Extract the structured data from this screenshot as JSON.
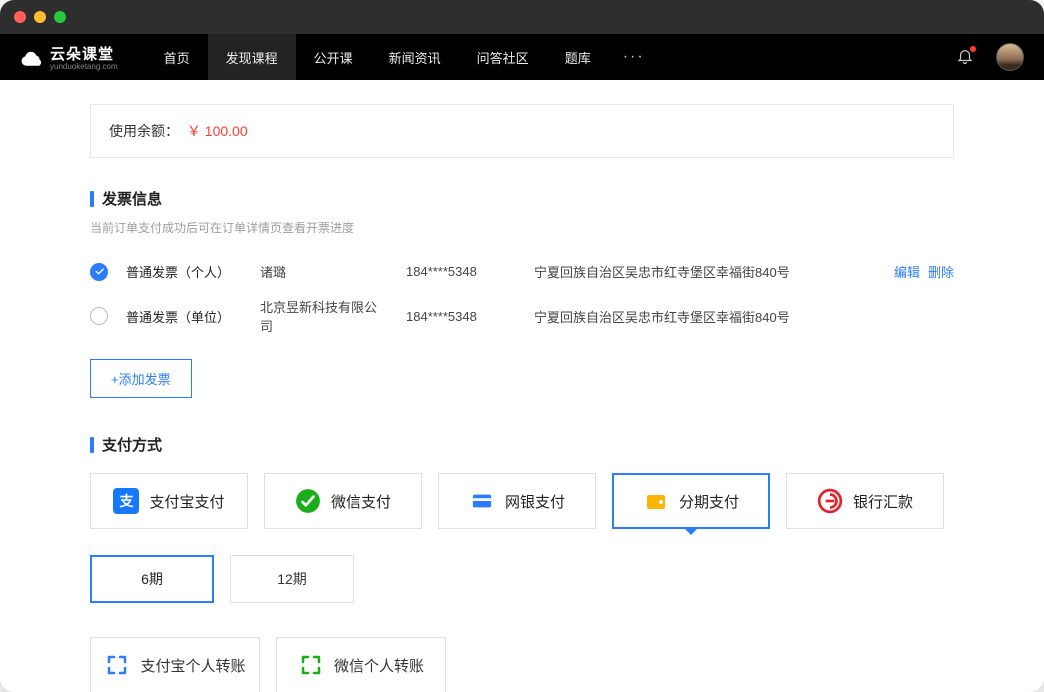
{
  "nav": {
    "logo_text": "云朵课堂",
    "logo_sub": "yunduoketang.com",
    "items": [
      "首页",
      "发现课程",
      "公开课",
      "新闻资讯",
      "问答社区",
      "题库"
    ],
    "active_index": 1
  },
  "balance": {
    "label": "使用余额：",
    "amount": "￥ 100.00"
  },
  "invoice": {
    "title": "发票信息",
    "subtitle": "当前订单支付成功后可在订单详情页查看开票进度",
    "rows": [
      {
        "type": "普通发票（个人）",
        "name": "诸璐",
        "phone": "184****5348",
        "address": "宁夏回族自治区吴忠市红寺堡区幸福街840号",
        "checked": true,
        "actions": [
          "编辑",
          "删除"
        ]
      },
      {
        "type": "普通发票（单位）",
        "name": "北京昱新科技有限公司",
        "phone": "184****5348",
        "address": "宁夏回族自治区吴忠市红寺堡区幸福街840号",
        "checked": false,
        "actions": []
      }
    ],
    "add_label": "+添加发票"
  },
  "payment": {
    "title": "支付方式",
    "methods": [
      {
        "label": "支付宝支付",
        "icon": "alipay"
      },
      {
        "label": "微信支付",
        "icon": "wechat"
      },
      {
        "label": "网银支付",
        "icon": "bank-card"
      },
      {
        "label": "分期支付",
        "icon": "wallet",
        "selected": true
      },
      {
        "label": "银行汇款",
        "icon": "bank-transfer"
      }
    ],
    "installments": [
      {
        "label": "6期",
        "selected": true
      },
      {
        "label": "12期",
        "selected": false
      }
    ],
    "transfers": [
      {
        "label": "支付宝个人转账",
        "icon": "scan-blue"
      },
      {
        "label": "微信个人转账",
        "icon": "scan-green"
      }
    ]
  }
}
